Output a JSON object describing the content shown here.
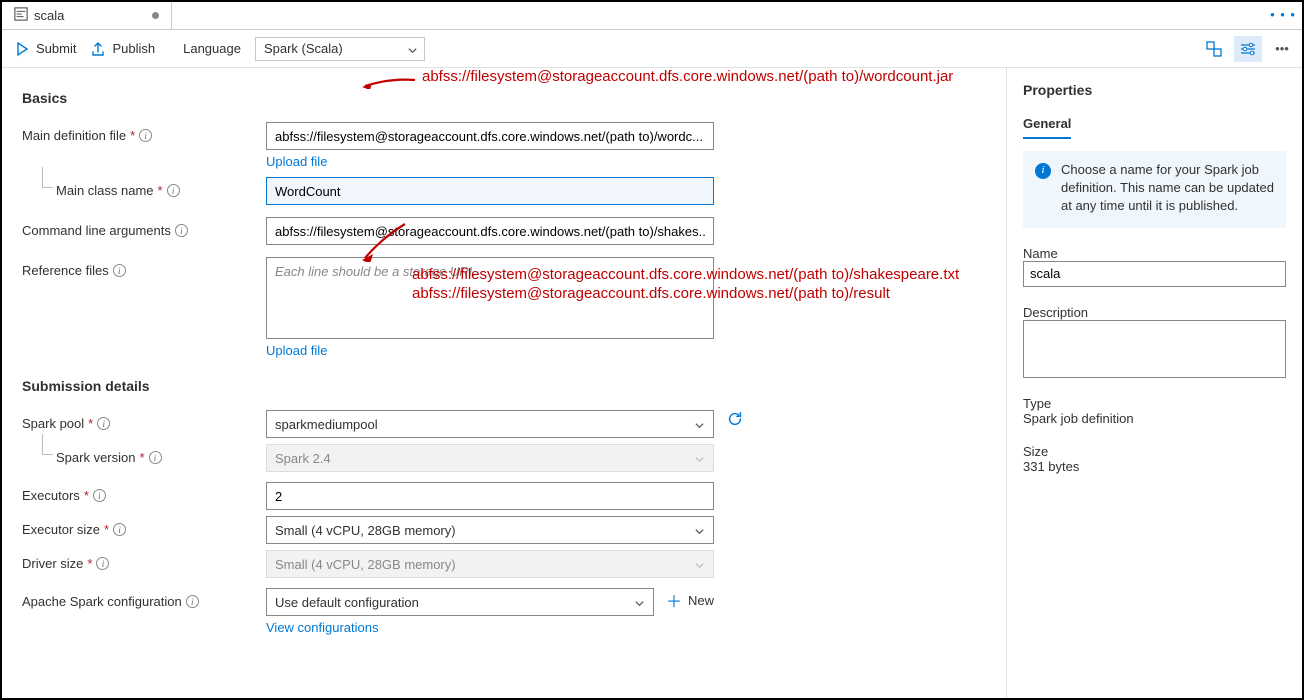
{
  "tab": {
    "title": "scala"
  },
  "toolbar": {
    "submit": "Submit",
    "publish": "Publish",
    "language_label": "Language",
    "language_value": "Spark (Scala)"
  },
  "annotations": {
    "a1": "abfss://filesystem@storageaccount.dfs.core.windows.net/(path to)/wordcount.jar",
    "a2": "abfss://filesystem@storageaccount.dfs.core.windows.net/(path to)/shakespeare.txt",
    "a3": "abfss://filesystem@storageaccount.dfs.core.windows.net/(path to)/result"
  },
  "sections": {
    "basics": "Basics",
    "submission": "Submission details"
  },
  "form": {
    "main_def_label": "Main definition file",
    "main_def_value": "abfss://filesystem@storageaccount.dfs.core.windows.net/(path to)/wordc...",
    "upload_file": "Upload file",
    "main_class_label": "Main class name",
    "main_class_value": "WordCount",
    "cli_args_label": "Command line arguments",
    "cli_args_value": "abfss://filesystem@storageaccount.dfs.core.windows.net/(path to)/shakes...",
    "ref_files_label": "Reference files",
    "ref_files_placeholder": "Each line should be a storage URI.",
    "spark_pool_label": "Spark pool",
    "spark_pool_value": "sparkmediumpool",
    "spark_version_label": "Spark version",
    "spark_version_value": "Spark 2.4",
    "executors_label": "Executors",
    "executors_value": "2",
    "executor_size_label": "Executor size",
    "executor_size_value": "Small (4 vCPU, 28GB memory)",
    "driver_size_label": "Driver size",
    "driver_size_value": "Small (4 vCPU, 28GB memory)",
    "spark_conf_label": "Apache Spark configuration",
    "spark_conf_value": "Use default configuration",
    "new_btn": "New",
    "view_conf": "View configurations"
  },
  "props": {
    "title": "Properties",
    "tab_general": "General",
    "infobox": "Choose a name for your Spark job definition. This name can be updated at any time until it is published.",
    "name_label": "Name",
    "name_value": "scala",
    "desc_label": "Description",
    "type_label": "Type",
    "type_value": "Spark job definition",
    "size_label": "Size",
    "size_value": "331 bytes"
  }
}
